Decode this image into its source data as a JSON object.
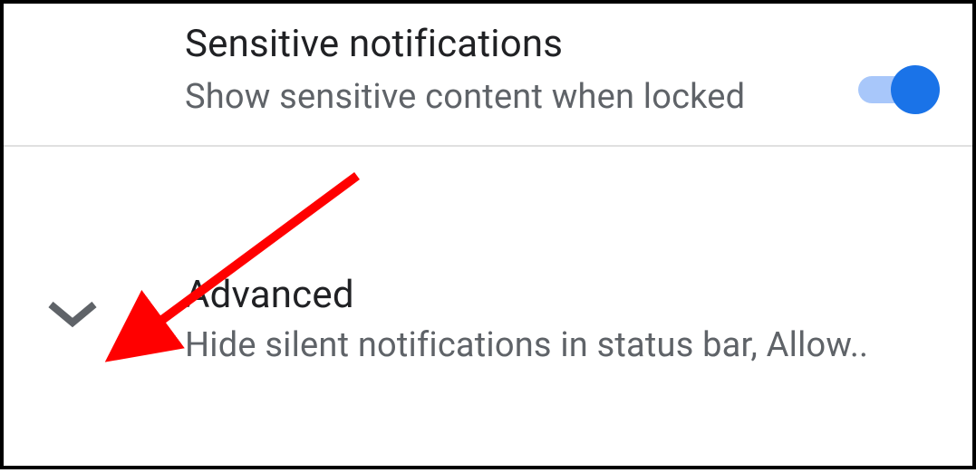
{
  "settings": {
    "sensitive": {
      "title": "Sensitive notifications",
      "subtitle": "Show sensitive content when locked",
      "toggled": true
    },
    "advanced": {
      "title": "Advanced",
      "subtitle": "Hide silent notifications in status bar, Allow.."
    }
  },
  "colors": {
    "toggle_on_thumb": "#1a73e8",
    "toggle_on_track": "#a8c7fa",
    "arrow_annotation": "#ff0000"
  }
}
